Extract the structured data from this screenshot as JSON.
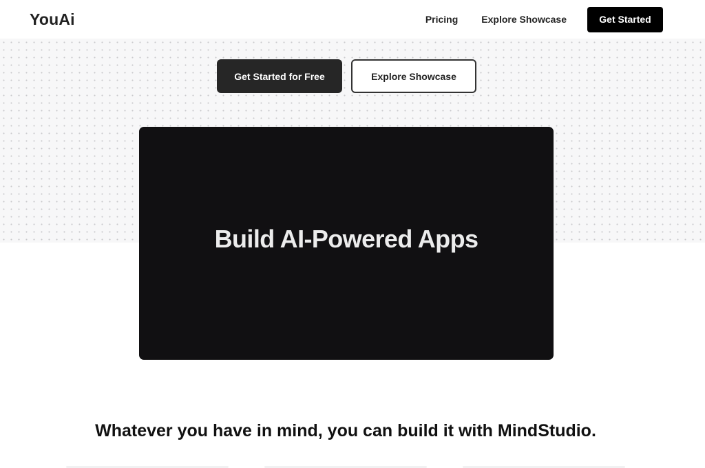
{
  "header": {
    "logo": "YouAi",
    "nav": {
      "pricing": "Pricing",
      "explore_showcase": "Explore Showcase",
      "get_started": "Get Started"
    }
  },
  "hero": {
    "primary_button": "Get Started for Free",
    "secondary_button": "Explore Showcase",
    "video_title": "Build AI-Powered Apps"
  },
  "tagline": "Whatever you have in mind, you can build it with MindStudio.",
  "colors": {
    "primary": "#000000",
    "primary_button": "#262626",
    "video_background": "#111012",
    "hero_background": "#f7f7f8"
  }
}
